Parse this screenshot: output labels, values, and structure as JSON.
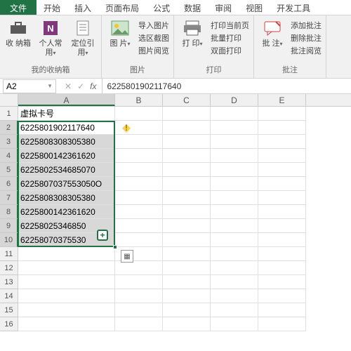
{
  "tabs": {
    "file": "文件",
    "items": [
      "开始",
      "插入",
      "页面布局",
      "公式",
      "数据",
      "审阅",
      "视图",
      "开发工具"
    ]
  },
  "ribbon": {
    "group1": {
      "btn1": "收\n纳箱",
      "btn2": "个人常\n用",
      "btn3": "定位引\n用",
      "label": "我的收纳箱",
      "caret": "▾"
    },
    "group2": {
      "btn": "图\n片",
      "links": [
        "导入图片",
        "选区截图",
        "图片阅览"
      ],
      "label": "图片"
    },
    "group3": {
      "btn": "打\n印",
      "links": [
        "打印当前页",
        "批量打印",
        "双面打印"
      ],
      "label": "打印"
    },
    "group4": {
      "btn": "批\n注",
      "links": [
        "添加批注",
        "删除批注",
        "批注阅览"
      ],
      "label": "批注"
    }
  },
  "formula_bar": {
    "name_box": "A2",
    "value": "6225801902117640"
  },
  "columns": [
    "A",
    "B",
    "C",
    "D",
    "E"
  ],
  "header_row": "虚拟卡号",
  "data": [
    "6225801902117640",
    "6225808308305380",
    "6225800142361620",
    "6225802534685070",
    "6225807037553050O",
    "6225808308305380",
    "6225800142361620",
    "62258025346850",
    "62258070375530"
  ],
  "colors": {
    "accent": "#217346"
  }
}
